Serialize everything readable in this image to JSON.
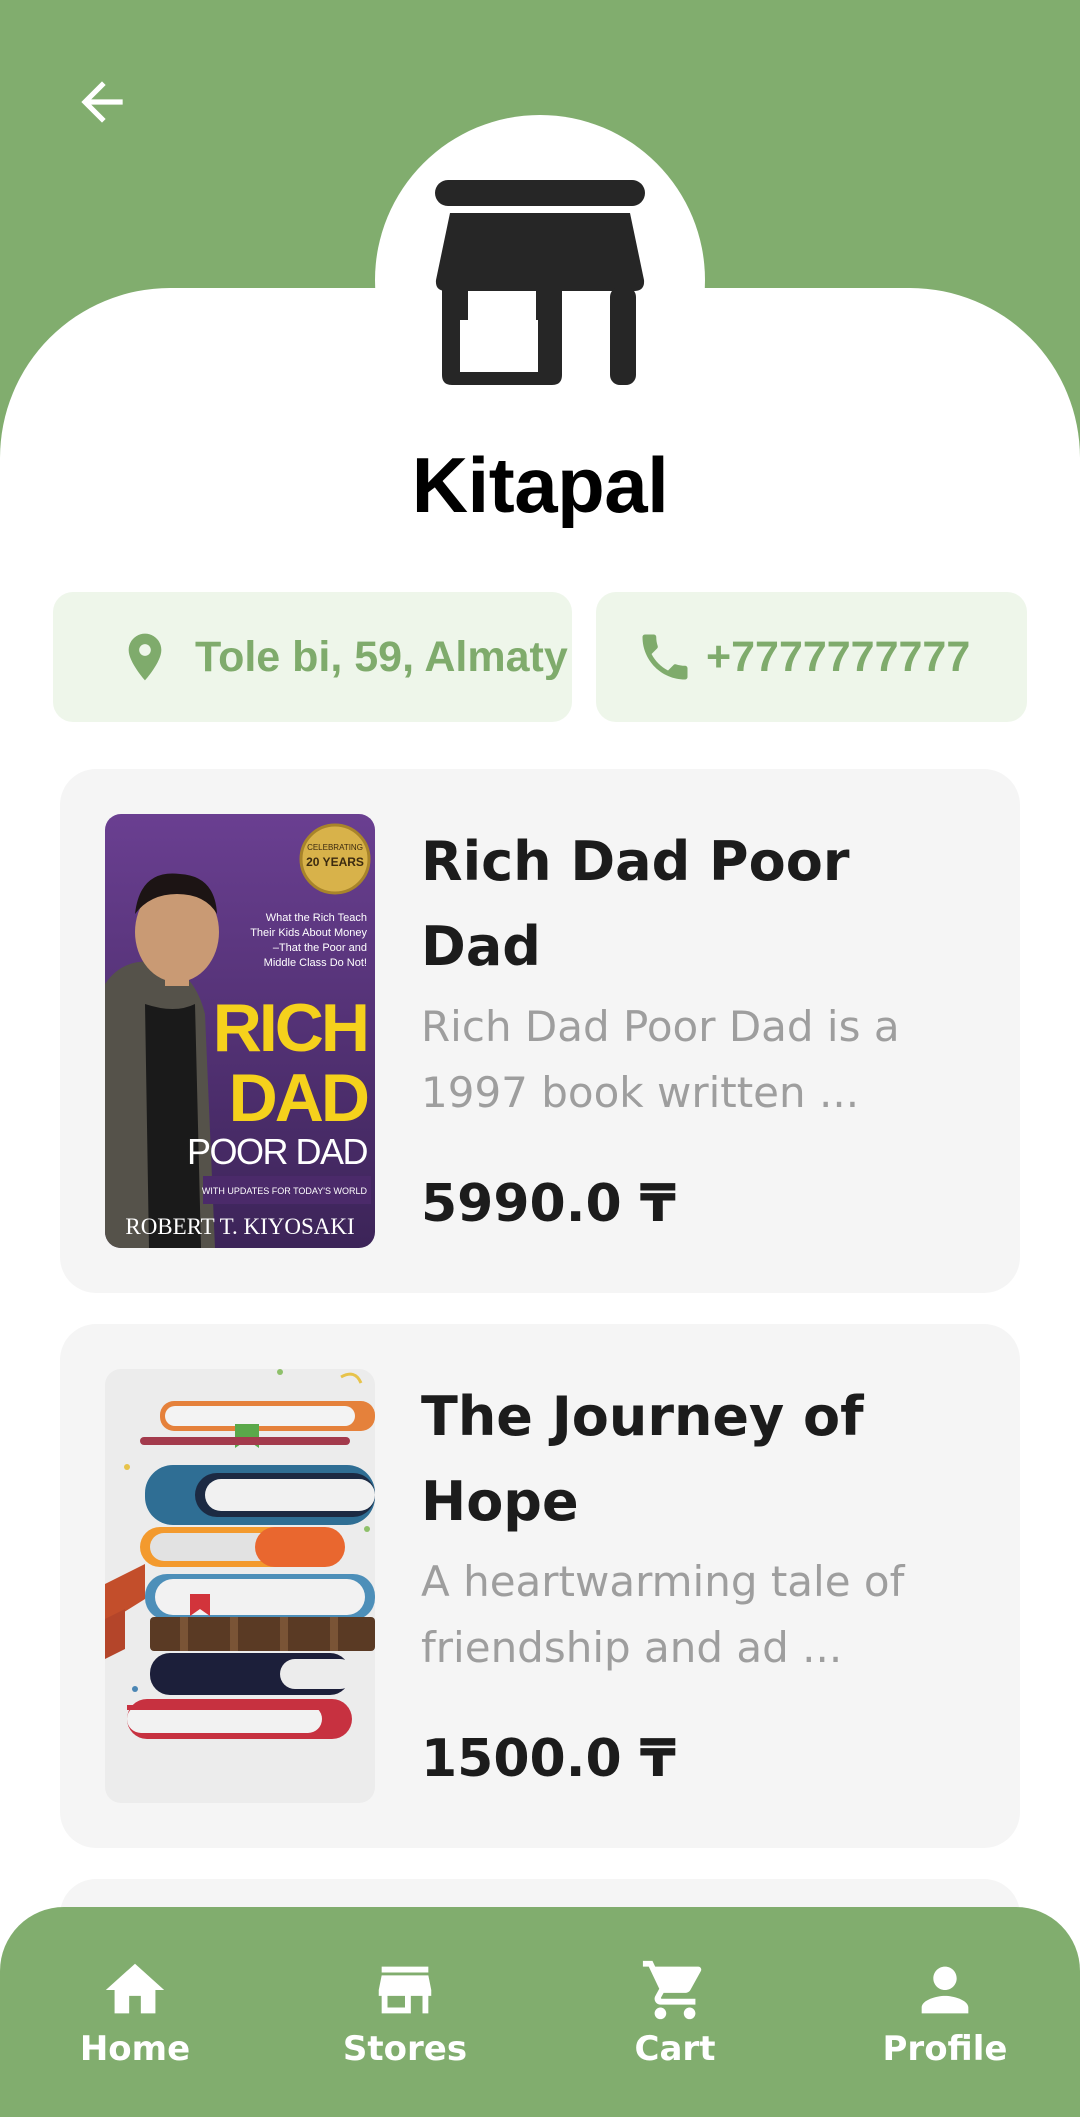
{
  "colors": {
    "brand_green": "#81ad6e",
    "chip_bg": "#eef6ea",
    "chip_text": "#7fab6c",
    "card_bg": "#f5f5f5",
    "title_text": "#1c1c1c",
    "desc_text": "#9e9e9e"
  },
  "header": {
    "back_icon": "arrow-left-icon",
    "store_icon": "storefront-icon"
  },
  "store": {
    "name": "Kitapal",
    "address": "Tole bi, 59, Almaty",
    "address_icon": "location-pin-icon",
    "phone": "+7777777777",
    "phone_icon": "phone-icon"
  },
  "books": [
    {
      "title": "Rich Dad Poor Dad",
      "description": "Rich Dad Poor Dad is a 1997 book written ...",
      "price": "5990.0 ₸",
      "cover": {
        "author": "ROBERT T. KIYOSAKI",
        "badge_line1": "CELEBRATING",
        "badge_line2": "20 YEARS",
        "tagline_1": "What the Rich Teach",
        "tagline_2": "Their Kids About Money",
        "tagline_3": "–That the Poor and",
        "tagline_4": "Middle Class Do Not!",
        "title_1": "RICH",
        "title_2": "DAD",
        "title_3": "POOR DAD",
        "strip": "WITH UPDATES FOR TODAY'S WORLD"
      }
    },
    {
      "title": "The Journey of Hope",
      "description": "A heartwarming tale of friendship and ad ...",
      "price": "1500.0 ₸",
      "cover": {
        "illustration": "stack-of-books-icon"
      }
    }
  ],
  "nav": [
    {
      "label": "Home",
      "icon": "home-icon"
    },
    {
      "label": "Stores",
      "icon": "store-icon"
    },
    {
      "label": "Cart",
      "icon": "cart-icon"
    },
    {
      "label": "Profile",
      "icon": "person-icon"
    }
  ]
}
